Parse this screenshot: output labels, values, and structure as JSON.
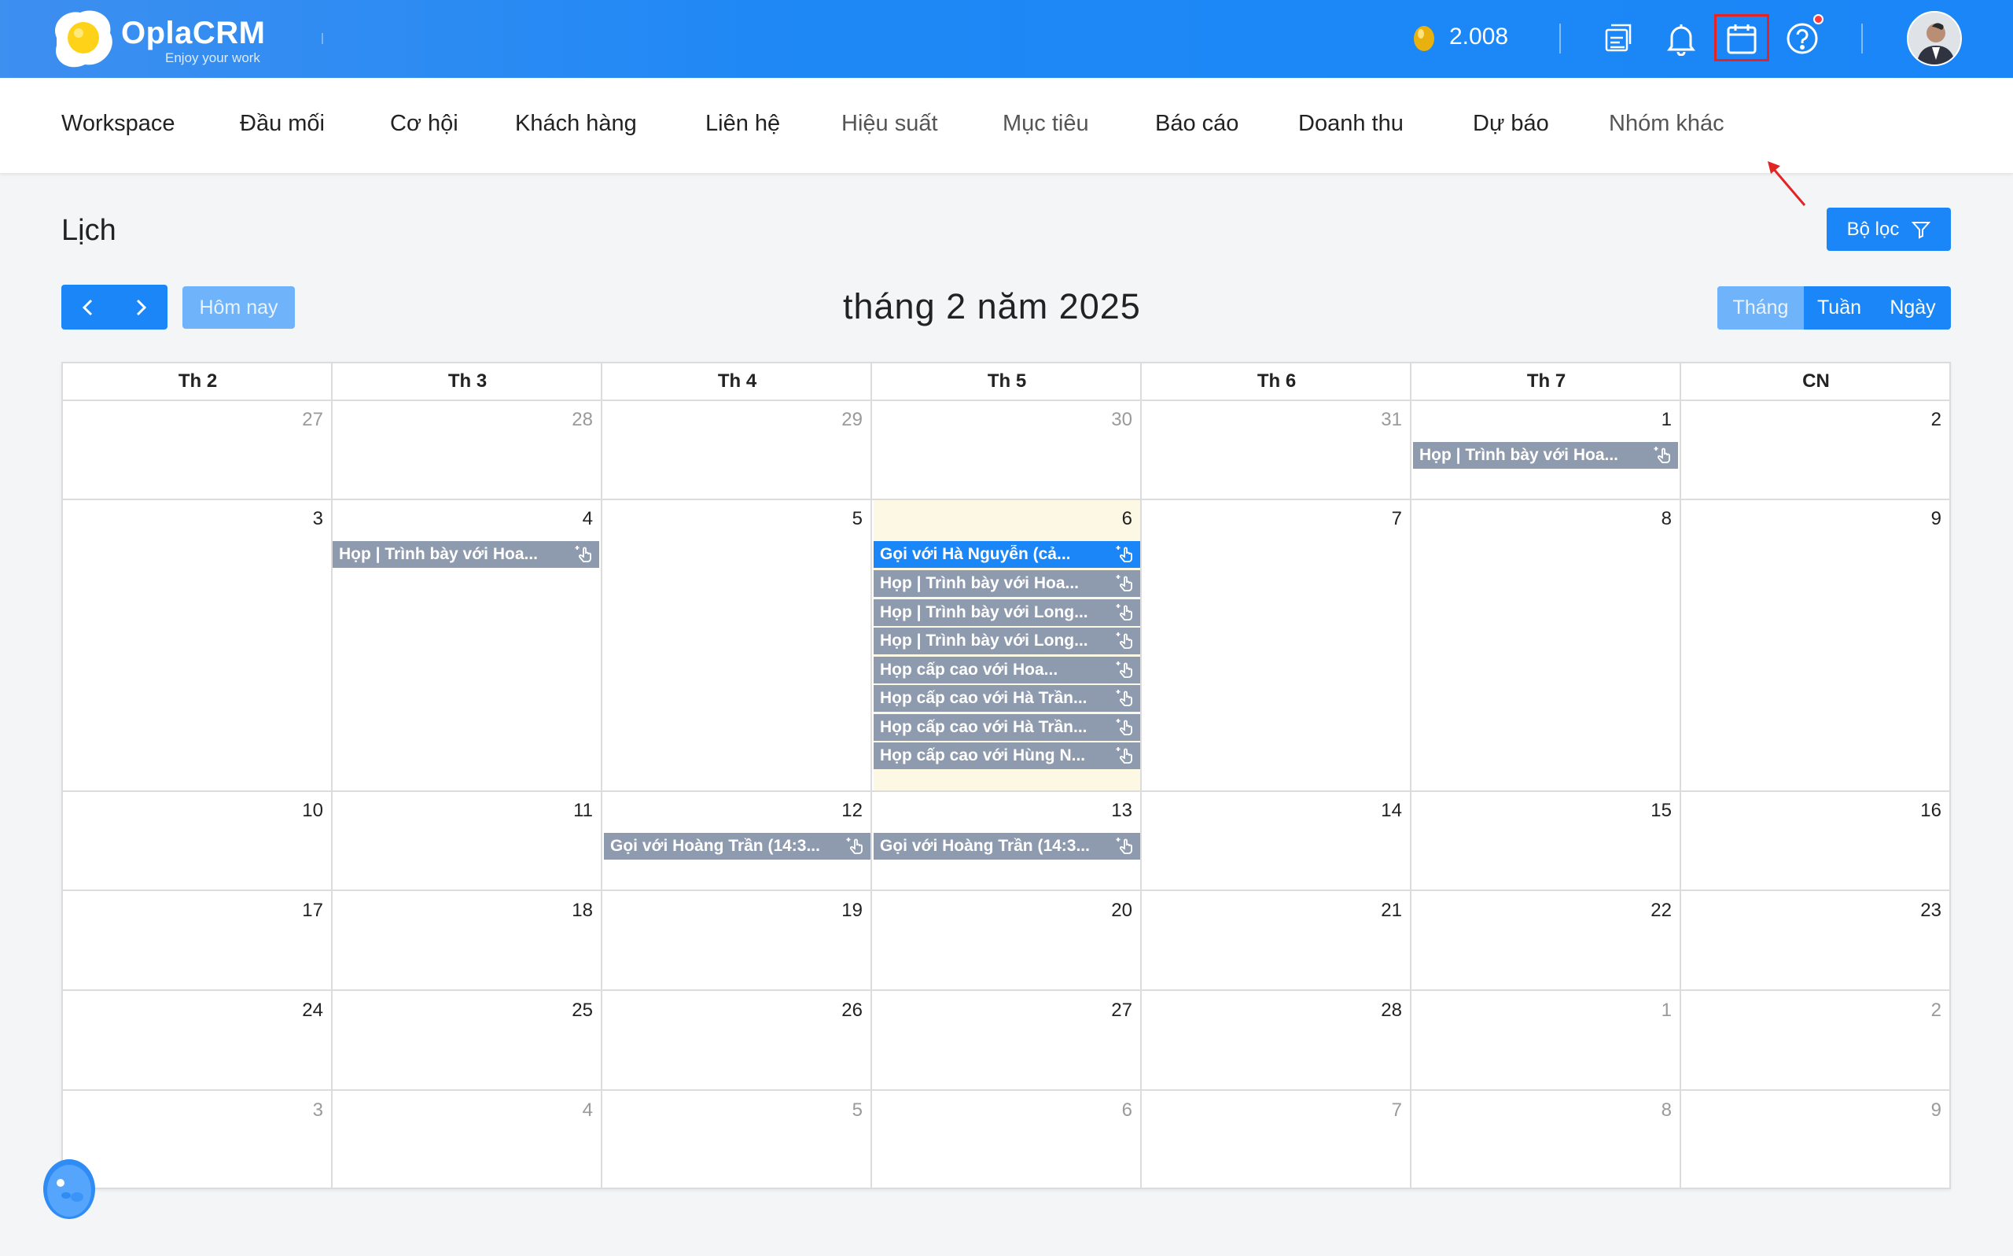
{
  "topbar": {
    "logo_text": "OplaCRM",
    "logo_tagline": "Enjoy your work",
    "coins": "2.008",
    "icons": [
      "report-icon",
      "bell-icon",
      "calendar-icon",
      "help-icon"
    ],
    "highlight_color": "#e32424"
  },
  "nav": {
    "items": [
      "Workspace",
      "Đầu mối",
      "Cơ hội",
      "Khách hàng",
      "Liên hệ",
      "Hiệu suất",
      "Mục tiêu",
      "Báo cáo",
      "Doanh thu",
      "Dự báo",
      "Nhóm khác"
    ]
  },
  "page": {
    "title": "Lịch",
    "filter_label": "Bộ lọc",
    "today_label": "Hôm nay",
    "month_title": "tháng 2 năm 2025",
    "views": [
      "Tháng",
      "Tuần",
      "Ngày"
    ],
    "active_view": "Tháng"
  },
  "calendar": {
    "weekdays": [
      "Th 2",
      "Th 3",
      "Th 4",
      "Th 5",
      "Th 6",
      "Th 7",
      "CN"
    ],
    "weeks": [
      [
        "27",
        "28",
        "29",
        "30",
        "31",
        "1",
        "2"
      ],
      [
        "3",
        "4",
        "5",
        "6",
        "7",
        "8",
        "9"
      ],
      [
        "10",
        "11",
        "12",
        "13",
        "14",
        "15",
        "16"
      ],
      [
        "17",
        "18",
        "19",
        "20",
        "21",
        "22",
        "23"
      ],
      [
        "24",
        "25",
        "26",
        "27",
        "28",
        "1",
        "2"
      ],
      [
        "3",
        "4",
        "5",
        "6",
        "7",
        "8",
        "9"
      ]
    ],
    "today": "6",
    "events": [
      {
        "title": "Họp | Trình bày với Hoa...",
        "primary": false
      },
      {
        "title": "Họp | Trình bày với Hoa...",
        "primary": false
      },
      {
        "title": "Gọi với Hà Nguyễn (cả...",
        "primary": true
      },
      {
        "title": "Họp | Trình bày với Hoa...",
        "primary": false
      },
      {
        "title": "Họp | Trình bày với Long...",
        "primary": false
      },
      {
        "title": "Họp | Trình bày với Long...",
        "primary": false
      },
      {
        "title": "Họp cấp cao với Hoa...",
        "primary": false
      },
      {
        "title": "Họp cấp cao với Hà Trần...",
        "primary": false
      },
      {
        "title": "Họp cấp cao với Hà Trần...",
        "primary": false
      },
      {
        "title": "Họp cấp cao với Hùng N...",
        "primary": false
      },
      {
        "title": "Gọi với Hoàng Trần (14:3...",
        "primary": false
      },
      {
        "title": "Gọi với Hoàng Trần (14:3...",
        "primary": false
      }
    ],
    "colors": {
      "event_gray": "#8e9aad",
      "event_blue": "#1a86f7",
      "today_bg": "#fdf8e3"
    }
  }
}
